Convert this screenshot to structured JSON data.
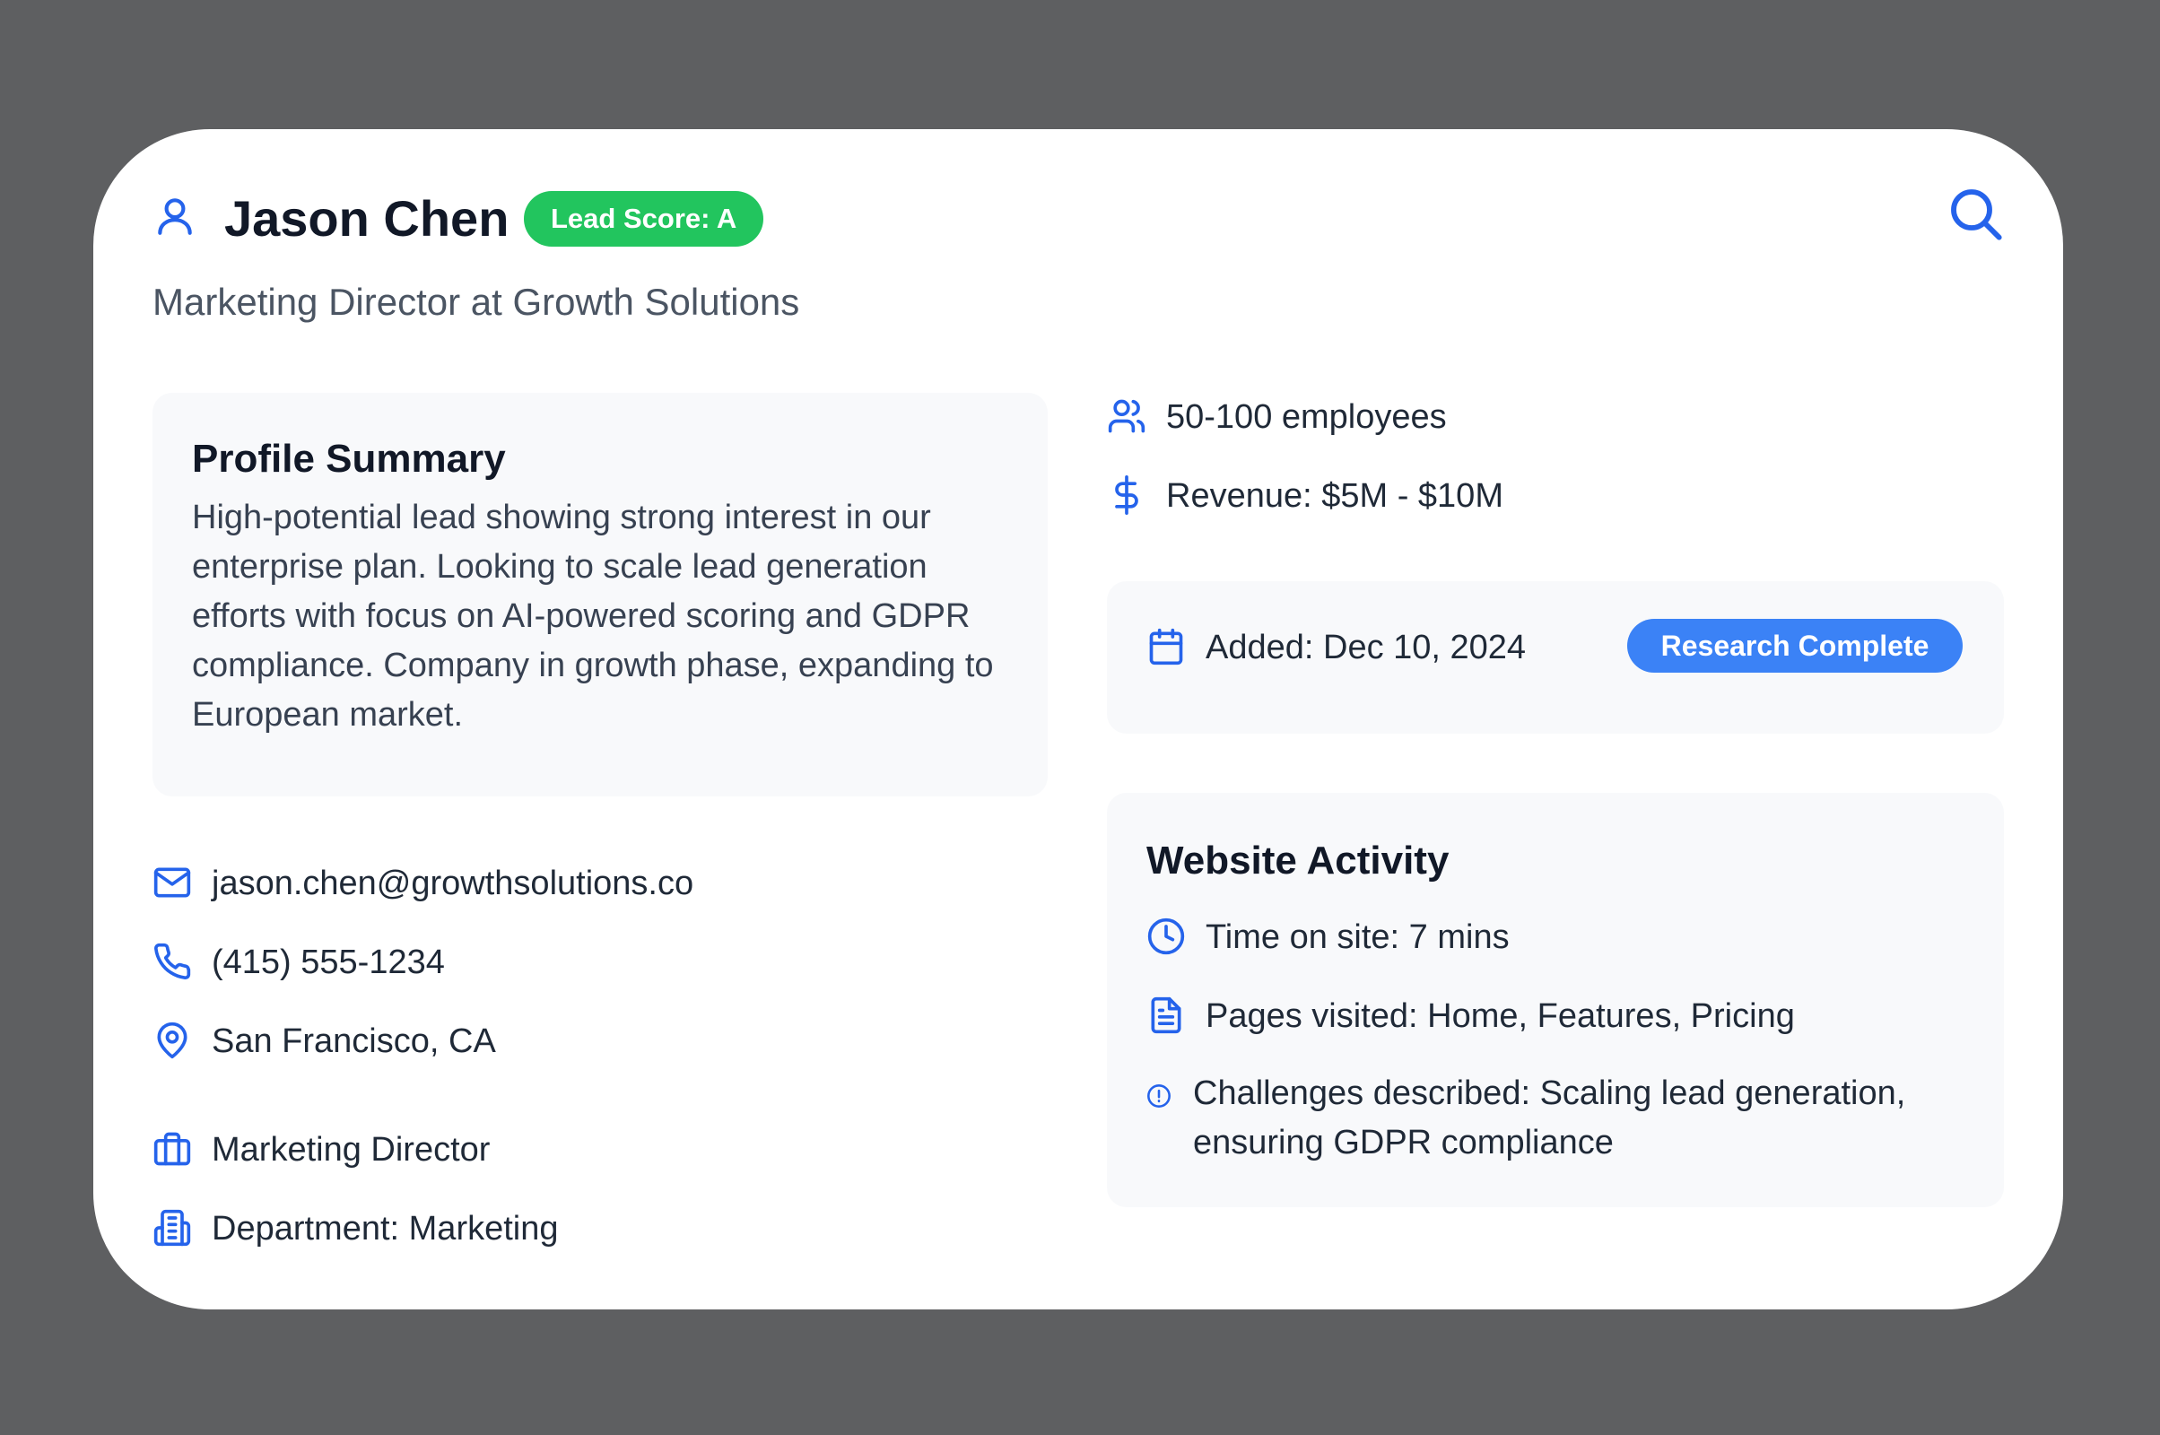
{
  "header": {
    "name": "Jason Chen",
    "lead_score": "Lead Score: A",
    "subtitle": "Marketing Director at Growth Solutions"
  },
  "summary": {
    "title": "Profile Summary",
    "text": "High-potential lead showing strong interest in our enterprise plan. Looking to scale lead generation efforts with focus on AI-powered scoring and GDPR compliance. Company in growth phase, expanding to European market."
  },
  "contact": {
    "email": "jason.chen@growthsolutions.co",
    "phone": "(415) 555-1234",
    "location": "San Francisco, CA"
  },
  "role": {
    "title": "Marketing Director",
    "department": "Department: Marketing"
  },
  "company": {
    "employees": "50-100 employees",
    "revenue": "Revenue: $5M - $10M"
  },
  "status": {
    "added": "Added: Dec 10, 2024",
    "badge": "Research Complete"
  },
  "activity": {
    "title": "Website Activity",
    "time": "Time on site: 7 mins",
    "pages": "Pages visited: Home, Features, Pricing",
    "challenges": "Challenges described: Scaling lead generation, ensuring GDPR compliance"
  },
  "colors": {
    "background": "#5e5f61",
    "card": "#ffffff",
    "accent_blue": "#2563eb",
    "lead_score_green": "#22c55e",
    "status_blue": "#3b82f6",
    "panel": "#f8f9fb"
  },
  "icons": {
    "person": "user-icon",
    "search": "search-icon",
    "email": "mail-icon",
    "phone": "phone-icon",
    "location": "map-pin-icon",
    "role": "briefcase-icon",
    "department": "building-icon",
    "employees": "users-icon",
    "revenue": "dollar-icon",
    "added": "calendar-icon",
    "time": "clock-icon",
    "pages": "document-icon",
    "challenges": "alert-circle-icon"
  }
}
